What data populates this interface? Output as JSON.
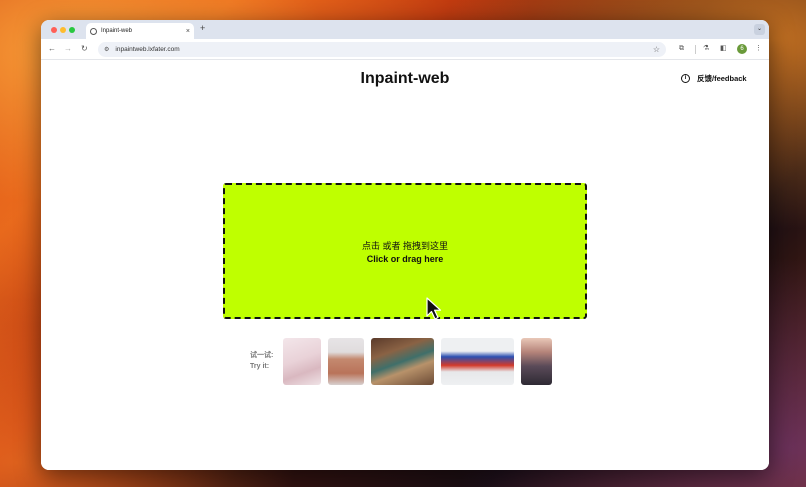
{
  "browser": {
    "tab_title": "Inpaint-web",
    "tab_close": "×",
    "new_tab": "+",
    "tab_menu": "⌄",
    "url": "inpaintweb.lxfater.com",
    "nav": {
      "back": "←",
      "forward": "→",
      "reload": "↻"
    },
    "omni_site_icon": "⚙",
    "star": "☆",
    "toolbar_icons": {
      "extensions": "⧉",
      "labs": "⚗",
      "sidepanel": "◧",
      "more": "⋮"
    },
    "avatar_letter": "6",
    "colors": {
      "tabbar": "#dde3ee",
      "omnibox": "#eef1f7"
    }
  },
  "page": {
    "title": "Inpaint-web",
    "feedback": {
      "icon_text": "i",
      "label": "反馈/feedback"
    },
    "dropzone": {
      "cn_label": "点击 或者 拖拽到这里",
      "en_label": "Click or drag here",
      "color": "#bfff00"
    },
    "try_it": {
      "cn_label": "试一试:",
      "en_label": "Try it:",
      "samples": [
        "sample-pink-outfit",
        "sample-sweater",
        "sample-desk-items",
        "sample-sneaker",
        "sample-city-street"
      ]
    }
  }
}
